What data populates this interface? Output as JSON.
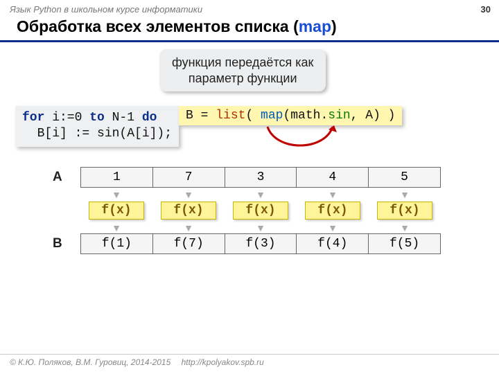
{
  "header": {
    "course": "Язык Python в школьном курсе информатики",
    "pageNumber": "30"
  },
  "title": {
    "prefix": "Обработка всех элементов списка (",
    "hl": "map",
    "suffix": ")"
  },
  "callout": {
    "line1": "функция передаётся как",
    "line2": "параметр функции"
  },
  "pascal": {
    "line1_kw1": "for",
    "line1_mid": " i:=0 ",
    "line1_kw2": "to",
    "line1_mid2": " N-1 ",
    "line1_kw3": "do",
    "line2": "  B[i] := sin(A[i]);"
  },
  "python": {
    "lhs": "B = ",
    "list": "list",
    "p1": "( ",
    "map": "map",
    "p2": "(math.",
    "sin": "sin",
    "p3": ", A) )"
  },
  "arrays": {
    "Alabel": "A",
    "Blabel": "B",
    "A": [
      "1",
      "7",
      "3",
      "4",
      "5"
    ],
    "fx": [
      "f(x)",
      "f(x)",
      "f(x)",
      "f(x)",
      "f(x)"
    ],
    "B": [
      "f(1)",
      "f(7)",
      "f(3)",
      "f(4)",
      "f(5)"
    ]
  },
  "footer": {
    "copyright": "© К.Ю. Поляков, В.М. Гуровиц, 2014-2015",
    "url": "http://kpolyakov.spb.ru"
  }
}
